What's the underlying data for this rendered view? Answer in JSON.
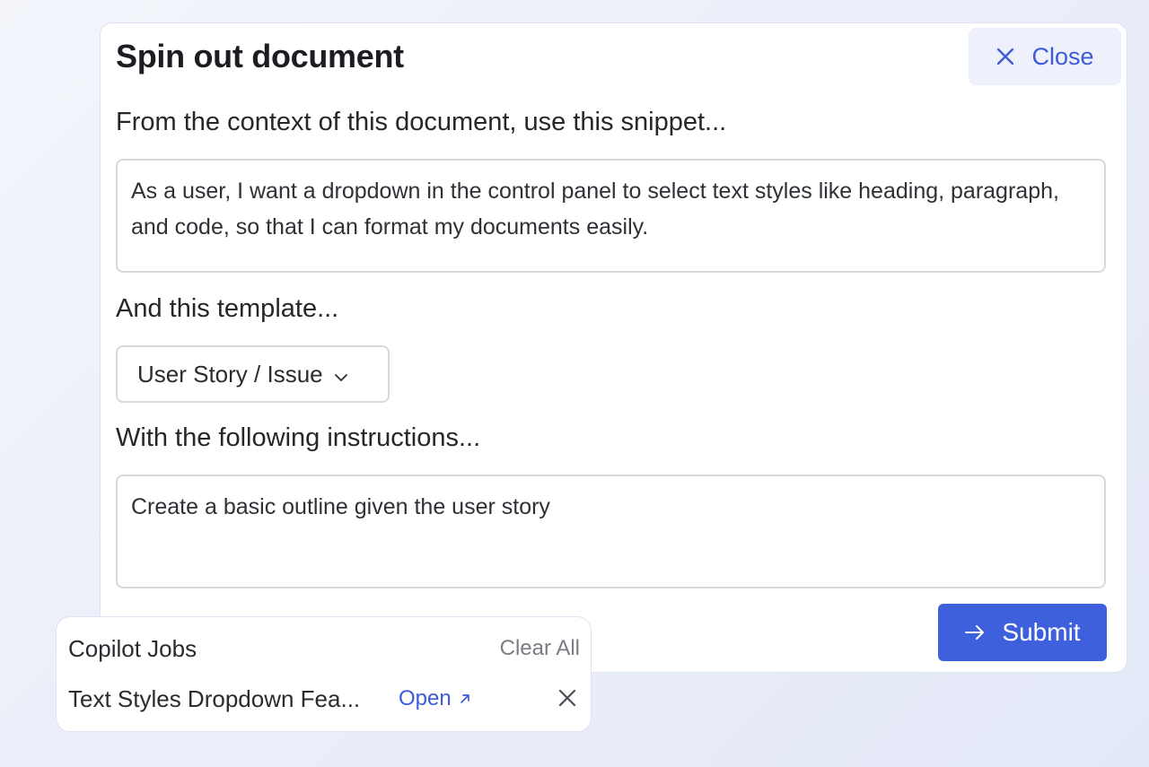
{
  "dialog": {
    "title": "Spin out document",
    "close_label": "Close",
    "snippet_label": "From the context of this document, use this snippet...",
    "snippet_text": "As a user, I want a dropdown in the control panel to select text styles like heading, paragraph, and code, so that I can format my documents easily.",
    "template_label": "And this template...",
    "template_selected": "User Story / Issue",
    "instructions_label": "With the following instructions...",
    "instructions_text": "Create a basic outline given the user story",
    "submit_label": "Submit"
  },
  "jobs": {
    "title": "Copilot Jobs",
    "clear_all_label": "Clear All",
    "items": [
      {
        "name": "Text Styles Dropdown Fea...",
        "open_label": "Open"
      }
    ]
  },
  "colors": {
    "accent": "#3e60dc",
    "accent_text": "#3d5bd9",
    "close_bg": "#eef0fb"
  },
  "icons": {
    "close": "x-icon",
    "submit": "arrow-right-icon",
    "dropdown": "chevron-down-icon",
    "open": "external-link-icon",
    "dismiss": "x-icon"
  }
}
